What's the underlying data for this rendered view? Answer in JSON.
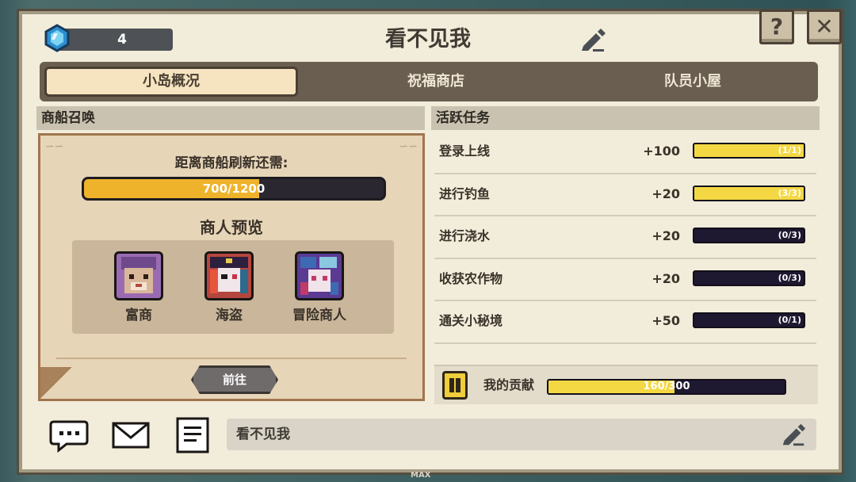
{
  "header": {
    "gem_count": "4",
    "title": "看不见我",
    "help_label": "?",
    "close_label": "✕"
  },
  "tabs": [
    {
      "label": "小岛概况",
      "active": true
    },
    {
      "label": "祝福商店",
      "active": false
    },
    {
      "label": "队员小屋",
      "active": false
    }
  ],
  "merchant_section": {
    "header": "商船召唤",
    "refresh_text": "距离商船刷新还需:",
    "progress_label": "700/1200",
    "progress_value": 700,
    "progress_max": 1200,
    "preview_title": "商人预览",
    "merchants": [
      {
        "name": "富商",
        "icon": "rich-merchant-avatar"
      },
      {
        "name": "海盗",
        "icon": "pirate-avatar"
      },
      {
        "name": "冒险商人",
        "icon": "adventure-merchant-avatar"
      }
    ],
    "go_label": "前往"
  },
  "task_section": {
    "header": "活跃任务",
    "tasks": [
      {
        "name": "登录上线",
        "reward": "+100",
        "progress": "(1/1)",
        "done": 1,
        "total": 1
      },
      {
        "name": "进行钓鱼",
        "reward": "+20",
        "progress": "(3/3)",
        "done": 3,
        "total": 3
      },
      {
        "name": "进行浇水",
        "reward": "+20",
        "progress": "(0/3)",
        "done": 0,
        "total": 3
      },
      {
        "name": "收获农作物",
        "reward": "+20",
        "progress": "(0/3)",
        "done": 0,
        "total": 3
      },
      {
        "name": "通关小秘境",
        "reward": "+50",
        "progress": "(0/1)",
        "done": 0,
        "total": 1
      }
    ],
    "contribution_label": "我的贡献",
    "contribution_progress": "160/300",
    "contribution_value": 160,
    "contribution_max": 300
  },
  "bottom": {
    "signature_text": "看不见我"
  },
  "footer": {
    "max_label": "MAX"
  },
  "colors": {
    "progress_fill": "#eeb32b",
    "task_fill": "#f4d843",
    "panel_bg": "#f2ecda"
  }
}
